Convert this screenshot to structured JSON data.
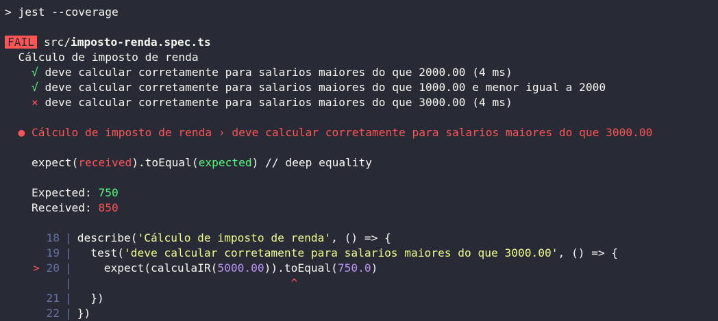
{
  "prompt": ">",
  "command": "jest --coverage",
  "result": {
    "badge": "FAIL",
    "path_dir": "src/",
    "path_file": "imposto-renda.spec.ts"
  },
  "suite": {
    "name": "Cálculo de imposto de renda",
    "tests": [
      {
        "mark": "√",
        "status": "pass",
        "name": "deve calcular corretamente para salarios maiores do que 2000.00",
        "time": "(4 ms)"
      },
      {
        "mark": "√",
        "status": "pass",
        "name": "deve calcular corretamente para salarios maiores do que 1000.00 e menor igual a 2000",
        "time": ""
      },
      {
        "mark": "×",
        "status": "fail",
        "name": "deve calcular corretamente para salarios maiores do que 3000.00",
        "time": "(4 ms)"
      }
    ]
  },
  "failure": {
    "bullet": "●",
    "title": "Cálculo de imposto de renda › deve calcular corretamente para salarios maiores do que 3000.00",
    "expect": {
      "prefix": "expect(",
      "received": "received",
      "middle": ").toEqual(",
      "expected": "expected",
      "suffix": ") // deep equality"
    },
    "expected_label": "Expected:",
    "expected_value": "750",
    "received_label": "Received:",
    "received_value": "850"
  },
  "code": {
    "l18_num": "18",
    "l18_a": "describe(",
    "l18_str": "'Cálculo de imposto de renda'",
    "l18_b": ", () => {",
    "l19_num": "19",
    "l19_a": "  test(",
    "l19_str": "'deve calcular corretamente para salarios maiores do que 3000.00'",
    "l19_b": ", () => {",
    "l20_marker": ">",
    "l20_num": "20",
    "l20_a": "    expect(calculaIR(",
    "l20_n1": "5000.00",
    "l20_b": ")).toEqual(",
    "l20_n2": "750.0",
    "l20_c": ")",
    "caret": "^",
    "l21_num": "21",
    "l21_text": "  })",
    "l22_num": "22",
    "l22_text": "})"
  },
  "colors": {
    "background": "#282a36",
    "fail": "#ff5555",
    "pass": "#50fa7b",
    "string": "#f1fa8c",
    "number": "#bd93f9",
    "gutter": "#6272a4"
  }
}
